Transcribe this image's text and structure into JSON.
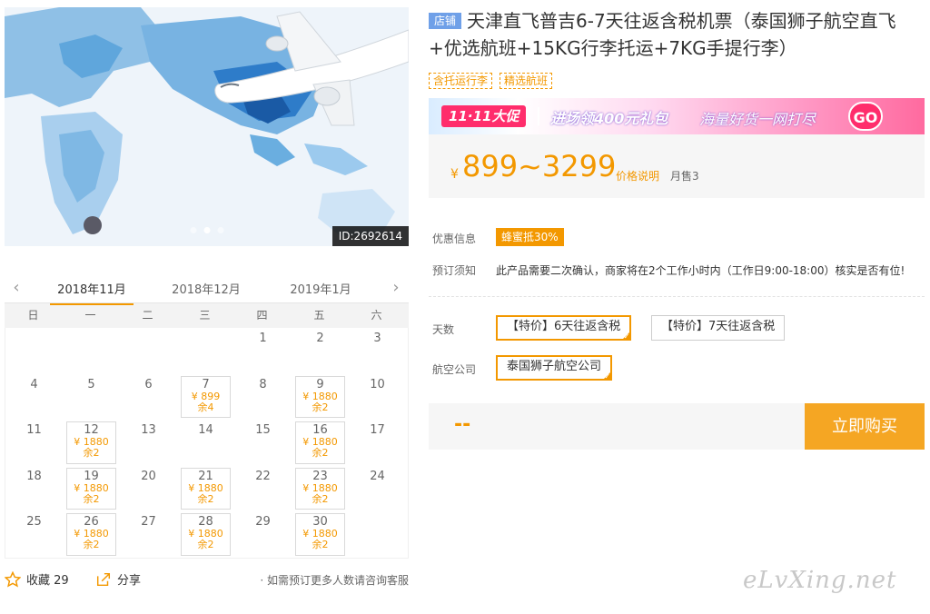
{
  "hero": {
    "id_badge": "ID:2692614"
  },
  "calendar": {
    "months": [
      "2018年11月",
      "2018年12月",
      "2019年1月"
    ],
    "weekdays": [
      "日",
      "一",
      "二",
      "三",
      "四",
      "五",
      "六"
    ],
    "rows": [
      [
        {
          "d": ""
        },
        {
          "d": ""
        },
        {
          "d": ""
        },
        {
          "d": ""
        },
        {
          "d": "1"
        },
        {
          "d": "2"
        },
        {
          "d": "3"
        }
      ],
      [
        {
          "d": "4"
        },
        {
          "d": "5"
        },
        {
          "d": "6"
        },
        {
          "d": "7",
          "p": "¥ 899",
          "r": "余4"
        },
        {
          "d": "8"
        },
        {
          "d": "9",
          "p": "¥ 1880",
          "r": "余2"
        },
        {
          "d": "10"
        }
      ],
      [
        {
          "d": "11"
        },
        {
          "d": "12",
          "p": "¥ 1880",
          "r": "余2"
        },
        {
          "d": "13"
        },
        {
          "d": "14"
        },
        {
          "d": "15"
        },
        {
          "d": "16",
          "p": "¥ 1880",
          "r": "余2"
        },
        {
          "d": "17"
        }
      ],
      [
        {
          "d": "18"
        },
        {
          "d": "19",
          "p": "¥ 1880",
          "r": "余2"
        },
        {
          "d": "20"
        },
        {
          "d": "21",
          "p": "¥ 1880",
          "r": "余2"
        },
        {
          "d": "22"
        },
        {
          "d": "23",
          "p": "¥ 1880",
          "r": "余2"
        },
        {
          "d": "24"
        }
      ],
      [
        {
          "d": "25"
        },
        {
          "d": "26",
          "p": "¥ 1880",
          "r": "余2"
        },
        {
          "d": "27"
        },
        {
          "d": "28",
          "p": "¥ 1880",
          "r": "余2"
        },
        {
          "d": "29"
        },
        {
          "d": "30",
          "p": "¥ 1880",
          "r": "余2"
        },
        {
          "d": ""
        }
      ]
    ]
  },
  "actions": {
    "favorite_label": "收藏 29",
    "share_label": "分享",
    "tip": "· 如需预订更多人数请咨询客服"
  },
  "product": {
    "shop_tag": "店铺",
    "title": "天津直飞普吉6-7天往返含税机票（泰国狮子航空直飞+优选航班+15KG行李托运+7KG手提行李）",
    "tags": [
      "含托运行李",
      "精选航班"
    ]
  },
  "promo": {
    "badge": "11·11大促",
    "text1": "进场领400元礼包",
    "text2": "海量好货一网打尽",
    "go": "GO"
  },
  "price": {
    "currency": "¥",
    "range": "899~3299",
    "note": "价格说明",
    "sold": "月售3"
  },
  "info": {
    "discount_label": "优惠信息",
    "discount_badge": "蜂蜜抵30%",
    "notice_label": "预订须知",
    "notice": "此产品需要二次确认，商家将在2个工作小时内（工作日9:00-18:00）核实是否有位!"
  },
  "options": {
    "days_label": "天数",
    "days": [
      "【特价】6天往返含税",
      "【特价】7天往返含税"
    ],
    "airline_label": "航空公司",
    "airline": "泰国狮子航空公司"
  },
  "buy": {
    "placeholder": "--",
    "button": "立即购买"
  },
  "watermark": "eLvXing.net",
  "colors": {
    "accent": "#f39800",
    "buy_button": "#f5a623",
    "shop_tag": "#6fa0e8"
  }
}
